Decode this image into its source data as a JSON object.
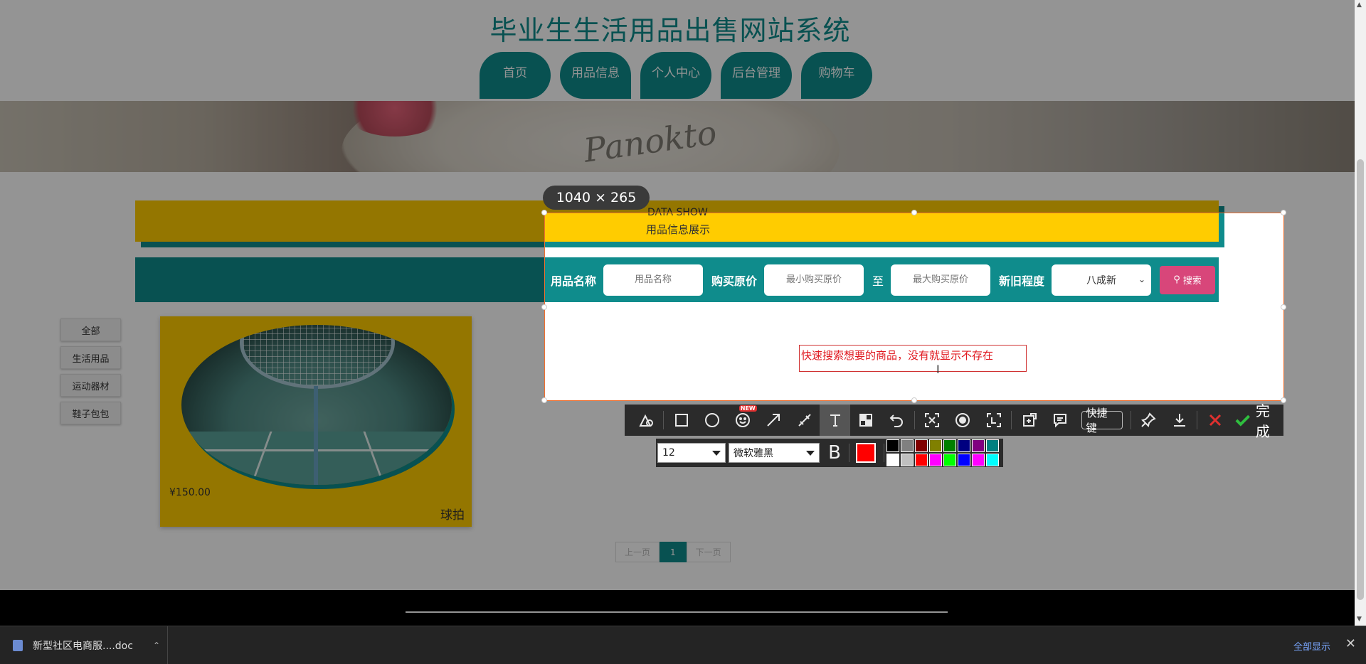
{
  "site": {
    "title": "毕业生生活用品出售网站系统",
    "nav": [
      "首页",
      "用品信息",
      "个人中心",
      "后台管理",
      "购物车"
    ],
    "banner_text": "Panokto"
  },
  "data_show": {
    "en": "DATA SHOW",
    "cn": "用品信息展示"
  },
  "search": {
    "name_label": "用品名称",
    "name_placeholder": "用品名称",
    "price_label": "购买原价",
    "min_placeholder": "最小购买原价",
    "to_label": "至",
    "max_placeholder": "最大购买原价",
    "condition_label": "新旧程度",
    "condition_value": "八成新",
    "search_button": "搜索"
  },
  "categories": [
    "全部",
    "生活用品",
    "运动器材",
    "鞋子包包"
  ],
  "product": {
    "price": "¥150.00",
    "name": "球拍"
  },
  "pagination": {
    "prev": "上一页",
    "current": "1",
    "next": "下一页"
  },
  "screenshot_tool": {
    "size": "1040 × 265",
    "text_annotation": "快速搜索想要的商品，没有就显示不存在",
    "new_badge": "NEW",
    "shortcut": "快捷键",
    "done": "完成",
    "font_size": "12",
    "font_name": "微软雅黑",
    "bold": "B",
    "current_color": "#ff0000",
    "swatches": [
      "#000000",
      "#808080",
      "#800000",
      "#808000",
      "#008000",
      "#000080",
      "#800080",
      "#008080",
      "#ffffff",
      "#c0c0c0",
      "#ff0000",
      "#ff00ff",
      "#00ff00",
      "#0000ff",
      "#ff00ff",
      "#00ffff"
    ]
  },
  "download_bar": {
    "file_name": "新型社区电商服....doc",
    "show_all": "全部显示"
  },
  "colors": {
    "teal": "#0f8c8c",
    "yellow": "#ffcc00",
    "pink": "#d8467a"
  }
}
